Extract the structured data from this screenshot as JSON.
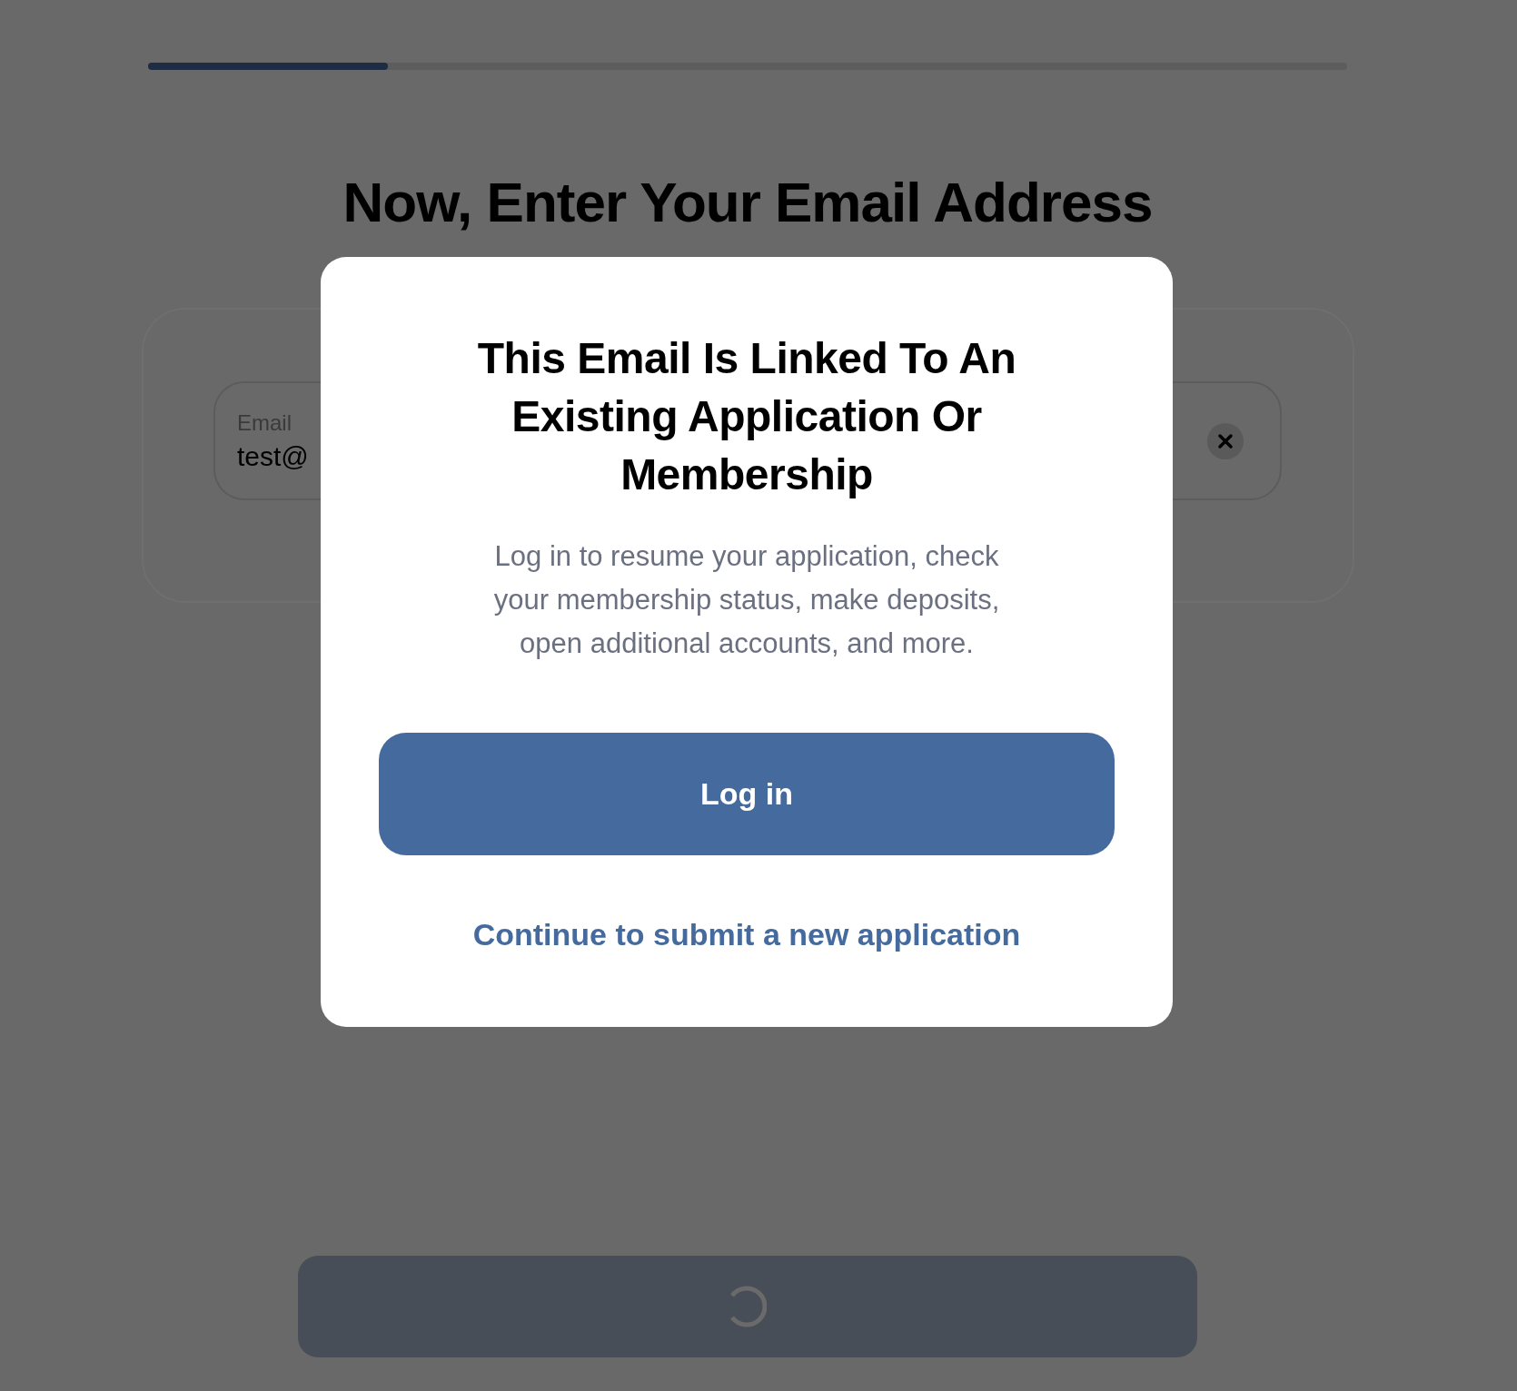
{
  "progress": {
    "level": 0.2
  },
  "heading": "Now, Enter Your Email Address",
  "email_field": {
    "label": "Email",
    "value": "test@"
  },
  "modal": {
    "title": "This Email Is Linked To An Existing Application Or Membership",
    "body": "Log in to resume your application, check your membership status, make deposits, open additional accounts, and more.",
    "primary_button": "Log in",
    "link": "Continue to submit a new application"
  },
  "submit_button": {
    "loading": true
  }
}
